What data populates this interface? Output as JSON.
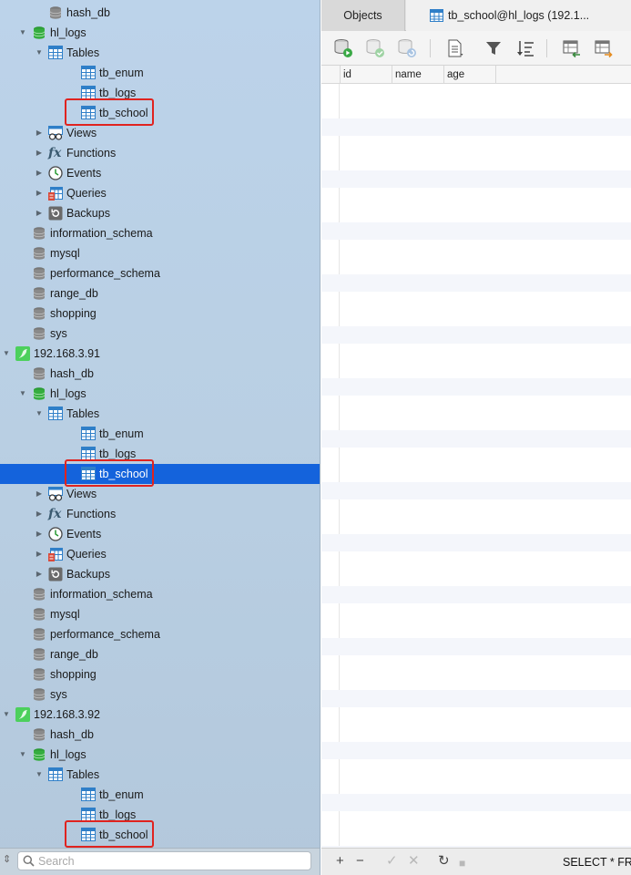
{
  "tree": [
    {
      "label": "hash_db",
      "icon": "database-icon",
      "level": 2,
      "disc": ""
    },
    {
      "label": "hl_logs",
      "icon": "database-open-icon",
      "level": 1,
      "disc": "open"
    },
    {
      "label": "Tables",
      "icon": "table-icon",
      "level": 2,
      "disc": "open"
    },
    {
      "label": "tb_enum",
      "icon": "table-icon",
      "level": 4,
      "disc": ""
    },
    {
      "label": "tb_logs",
      "icon": "table-icon",
      "level": 4,
      "disc": ""
    },
    {
      "label": "tb_school",
      "icon": "table-icon",
      "level": 4,
      "disc": "",
      "highlight": true
    },
    {
      "label": "Views",
      "icon": "views-icon",
      "level": 2,
      "disc": "closed"
    },
    {
      "label": "Functions",
      "icon": "function-icon",
      "level": 2,
      "disc": "closed"
    },
    {
      "label": "Events",
      "icon": "clock-icon",
      "level": 2,
      "disc": "closed"
    },
    {
      "label": "Queries",
      "icon": "query-icon",
      "level": 2,
      "disc": "closed"
    },
    {
      "label": "Backups",
      "icon": "backup-icon",
      "level": 2,
      "disc": "closed"
    },
    {
      "label": "information_schema",
      "icon": "database-icon",
      "level": 1,
      "disc": ""
    },
    {
      "label": "mysql",
      "icon": "database-icon",
      "level": 1,
      "disc": ""
    },
    {
      "label": "performance_schema",
      "icon": "database-icon",
      "level": 1,
      "disc": ""
    },
    {
      "label": "range_db",
      "icon": "database-icon",
      "level": 1,
      "disc": ""
    },
    {
      "label": "shopping",
      "icon": "database-icon",
      "level": 1,
      "disc": ""
    },
    {
      "label": "sys",
      "icon": "database-icon",
      "level": 1,
      "disc": ""
    },
    {
      "label": "192.168.3.91",
      "icon": "server-icon",
      "level": 0,
      "disc": "open"
    },
    {
      "label": "hash_db",
      "icon": "database-icon",
      "level": 1,
      "disc": ""
    },
    {
      "label": "hl_logs",
      "icon": "database-open-icon",
      "level": 1,
      "disc": "open"
    },
    {
      "label": "Tables",
      "icon": "table-icon",
      "level": 2,
      "disc": "open"
    },
    {
      "label": "tb_enum",
      "icon": "table-icon",
      "level": 4,
      "disc": ""
    },
    {
      "label": "tb_logs",
      "icon": "table-icon",
      "level": 4,
      "disc": ""
    },
    {
      "label": "tb_school",
      "icon": "table-icon",
      "level": 4,
      "disc": "",
      "highlight": true,
      "selected": true
    },
    {
      "label": "Views",
      "icon": "views-icon",
      "level": 2,
      "disc": "closed"
    },
    {
      "label": "Functions",
      "icon": "function-icon",
      "level": 2,
      "disc": "closed"
    },
    {
      "label": "Events",
      "icon": "clock-icon",
      "level": 2,
      "disc": "closed"
    },
    {
      "label": "Queries",
      "icon": "query-icon",
      "level": 2,
      "disc": "closed"
    },
    {
      "label": "Backups",
      "icon": "backup-icon",
      "level": 2,
      "disc": "closed"
    },
    {
      "label": "information_schema",
      "icon": "database-icon",
      "level": 1,
      "disc": ""
    },
    {
      "label": "mysql",
      "icon": "database-icon",
      "level": 1,
      "disc": ""
    },
    {
      "label": "performance_schema",
      "icon": "database-icon",
      "level": 1,
      "disc": ""
    },
    {
      "label": "range_db",
      "icon": "database-icon",
      "level": 1,
      "disc": ""
    },
    {
      "label": "shopping",
      "icon": "database-icon",
      "level": 1,
      "disc": ""
    },
    {
      "label": "sys",
      "icon": "database-icon",
      "level": 1,
      "disc": ""
    },
    {
      "label": "192.168.3.92",
      "icon": "server-icon",
      "level": 0,
      "disc": "open"
    },
    {
      "label": "hash_db",
      "icon": "database-icon",
      "level": 1,
      "disc": ""
    },
    {
      "label": "hl_logs",
      "icon": "database-open-icon",
      "level": 1,
      "disc": "open"
    },
    {
      "label": "Tables",
      "icon": "table-icon",
      "level": 2,
      "disc": "open"
    },
    {
      "label": "tb_enum",
      "icon": "table-icon",
      "level": 4,
      "disc": ""
    },
    {
      "label": "tb_logs",
      "icon": "table-icon",
      "level": 4,
      "disc": ""
    },
    {
      "label": "tb_school",
      "icon": "table-icon",
      "level": 4,
      "disc": "",
      "highlight": true
    }
  ],
  "search": {
    "placeholder": "Search",
    "value": ""
  },
  "tabs": {
    "objects": "Objects",
    "table": "tb_school@hl_logs (192.1..."
  },
  "toolbar_icons": [
    "begin-transaction-icon",
    "commit-icon",
    "rollback-icon",
    "text-view-icon",
    "filter-icon",
    "sort-icon",
    "import-icon",
    "export-icon"
  ],
  "grid": {
    "columns": [
      "id",
      "name",
      "age"
    ]
  },
  "bottombar": {
    "add": "+",
    "remove": "−",
    "apply": "✓",
    "discard": "✕",
    "refresh": "↻",
    "stop": "■",
    "sql": "SELECT * FR"
  },
  "colors": {
    "selection": "#1463dc",
    "highlight_box": "#e0231f",
    "sidebar_bg": "#bcd3ea"
  }
}
